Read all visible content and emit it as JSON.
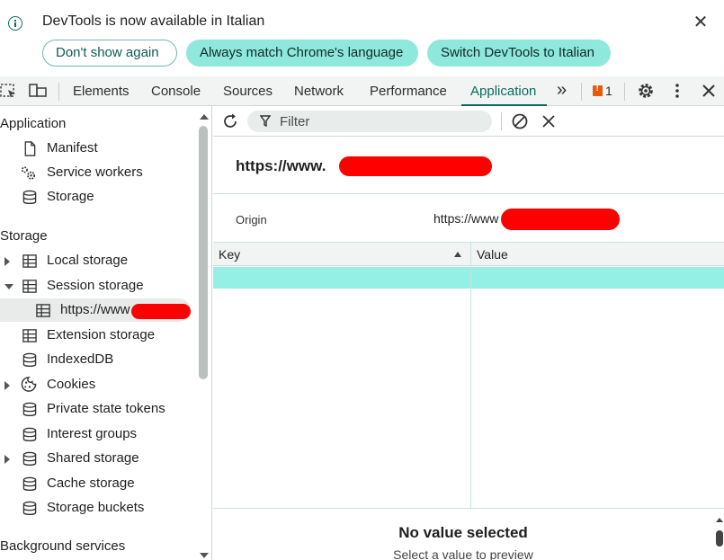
{
  "infobar": {
    "message": "DevTools is now available in Italian",
    "close_glyph": "✕",
    "buttons": {
      "dont_show": "Don't show again",
      "always_match": "Always match Chrome's language",
      "switch": "Switch DevTools to Italian"
    }
  },
  "toolbar": {
    "tabs": [
      "Elements",
      "Console",
      "Sources",
      "Network",
      "Performance",
      "Application"
    ],
    "active_tab": "Application",
    "more_glyph": "»",
    "issues_count": "1",
    "accent_color": "#0b6b5c"
  },
  "sidebar": {
    "application_title": "Application",
    "application_items": [
      "Manifest",
      "Service workers",
      "Storage"
    ],
    "storage_title": "Storage",
    "storage_items": [
      "Local storage",
      "Session storage",
      "https://www",
      "Extension storage",
      "IndexedDB",
      "Cookies",
      "Private state tokens",
      "Interest groups",
      "Shared storage",
      "Cache storage",
      "Storage buckets"
    ],
    "background_title": "Background services"
  },
  "main": {
    "filter_placeholder": "Filter",
    "origin_title": "https://www.",
    "origin_label": "Origin",
    "origin_value": "https://www",
    "columns": {
      "key": "Key",
      "value": "Value"
    },
    "preview_title": "No value selected",
    "preview_sub": "Select a value to preview"
  }
}
